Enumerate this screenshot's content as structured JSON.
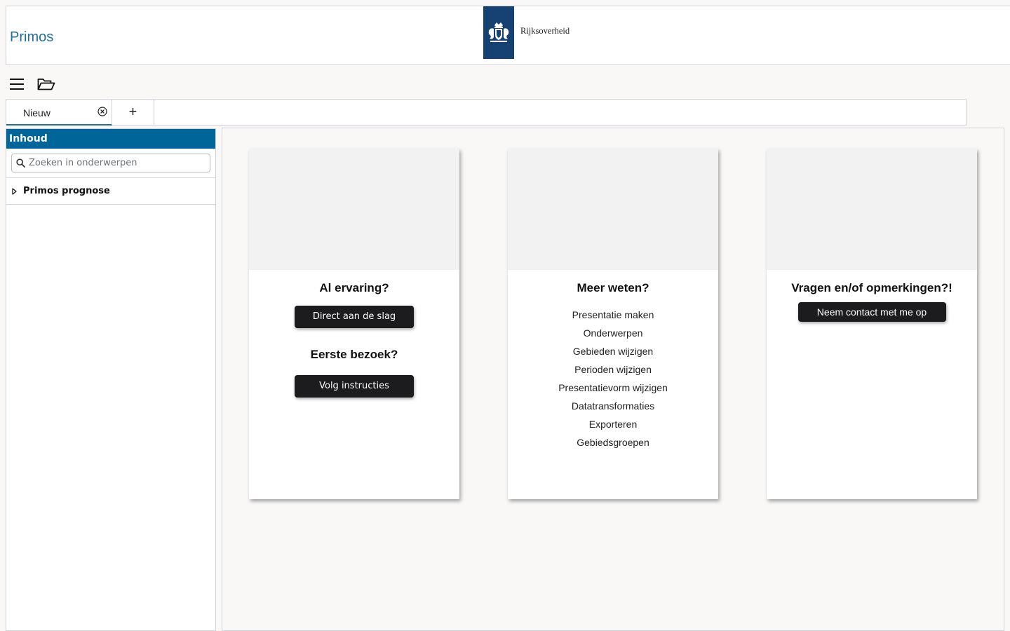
{
  "header": {
    "app_title": "Primos",
    "logo_text": "Rijksoverheid"
  },
  "toolbar": {
    "menu_icon": "hamburger-menu-icon",
    "open_icon": "open-folder-icon"
  },
  "tabs": [
    {
      "label": "Nieuw",
      "active": true
    }
  ],
  "tab_add_label": "+",
  "sidebar": {
    "title": "Inhoud",
    "search_placeholder": "Zoeken in onderwerpen",
    "items": [
      {
        "label": "Primos prognose",
        "expanded": false
      }
    ]
  },
  "cards": {
    "experience": {
      "title": "Al ervaring?",
      "button": "Direct aan de slag",
      "title2": "Eerste bezoek?",
      "button2": "Volg instructies"
    },
    "info": {
      "title": "Meer weten?",
      "links": [
        "Presentatie maken",
        "Onderwerpen",
        "Gebieden wijzigen",
        "Perioden wijzigen",
        "Presentatievorm wijzigen",
        "Datatransformaties",
        "Exporteren",
        "Gebiedsgroepen"
      ]
    },
    "contact": {
      "title": "Vragen en/of opmerkingen?!",
      "button": "Neem contact met me op"
    }
  },
  "colors": {
    "accent": "#006699",
    "title_blue": "#1f6fa1",
    "logo_blue": "#154273",
    "dark_button": "#1c1c1e",
    "page_bg": "#f9f8f7"
  }
}
